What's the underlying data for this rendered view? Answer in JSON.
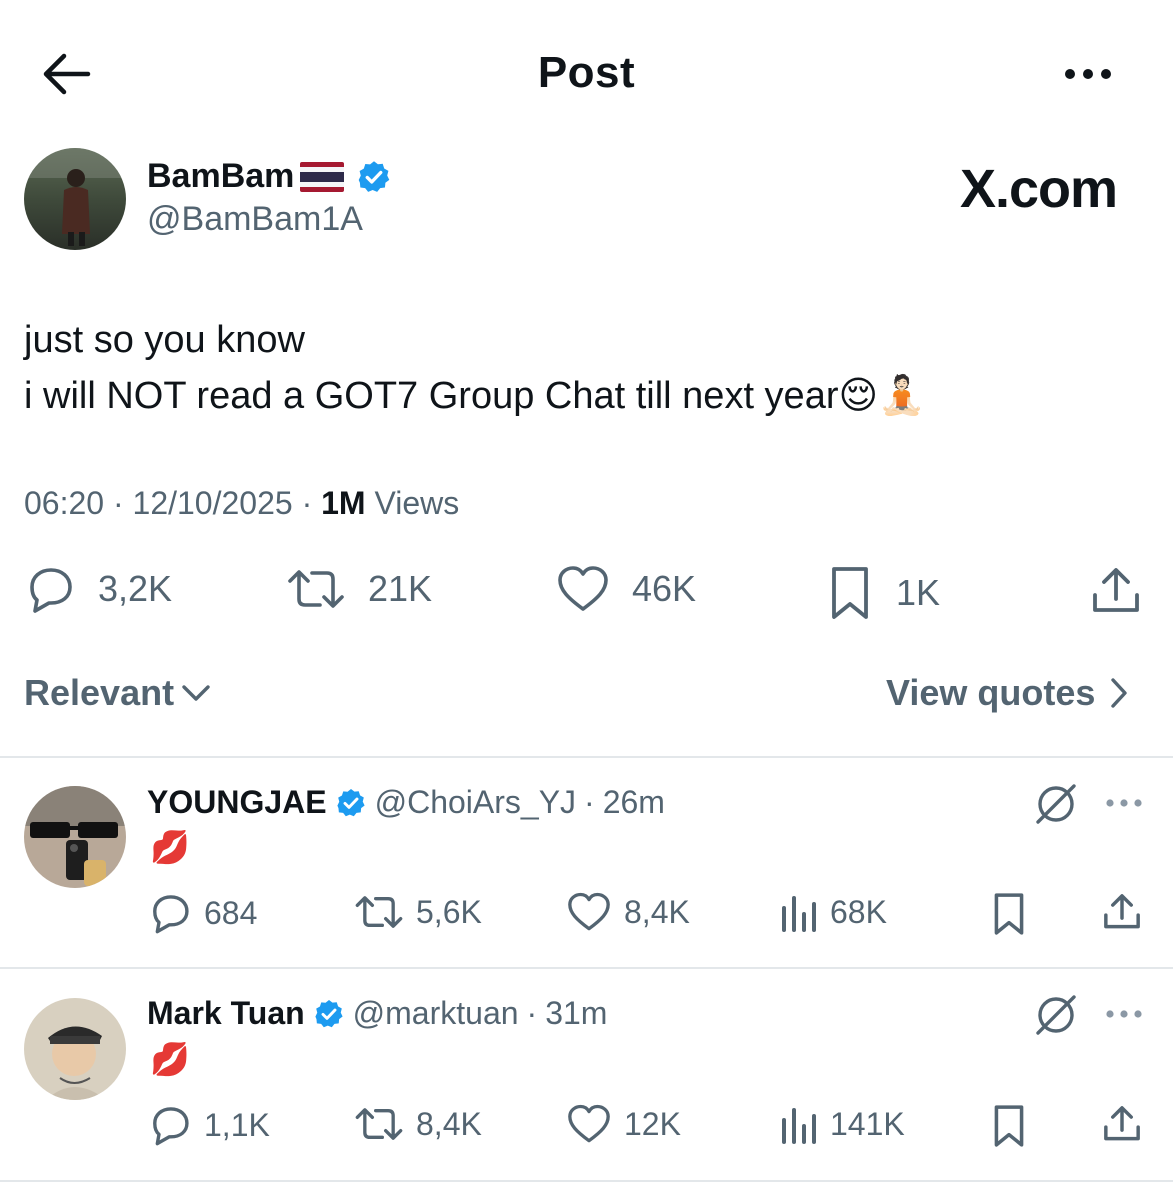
{
  "header": {
    "title": "Post"
  },
  "author": {
    "name": "BamBam",
    "handle": "@BamBam1A",
    "watermark": "X.com"
  },
  "post": {
    "text": "just so you know\ni will NOT read a GOT7 Group Chat till next year😌🧘🏻",
    "time": "06:20",
    "date": "12/10/2025",
    "views_count": "1M",
    "views_label": "Views",
    "stats": {
      "replies": "3,2K",
      "reposts": "21K",
      "likes": "46K",
      "bookmarks": "1K"
    }
  },
  "filters": {
    "sort_label": "Relevant",
    "quotes_label": "View quotes"
  },
  "replies": [
    {
      "name": "YOUNGJAE",
      "handle": "@ChoiArs_YJ",
      "time": "26m",
      "text": "💋",
      "stats": {
        "replies": "684",
        "reposts": "5,6K",
        "likes": "8,4K",
        "views": "68K"
      }
    },
    {
      "name": "Mark Tuan",
      "handle": "@marktuan",
      "time": "31m",
      "text": "💋",
      "stats": {
        "replies": "1,1K",
        "reposts": "8,4K",
        "likes": "12K",
        "views": "141K"
      }
    }
  ],
  "colors": {
    "verified": "#1d9bf0",
    "text": "#0f1419",
    "secondary": "#536471",
    "divider": "#e3e7ea"
  }
}
